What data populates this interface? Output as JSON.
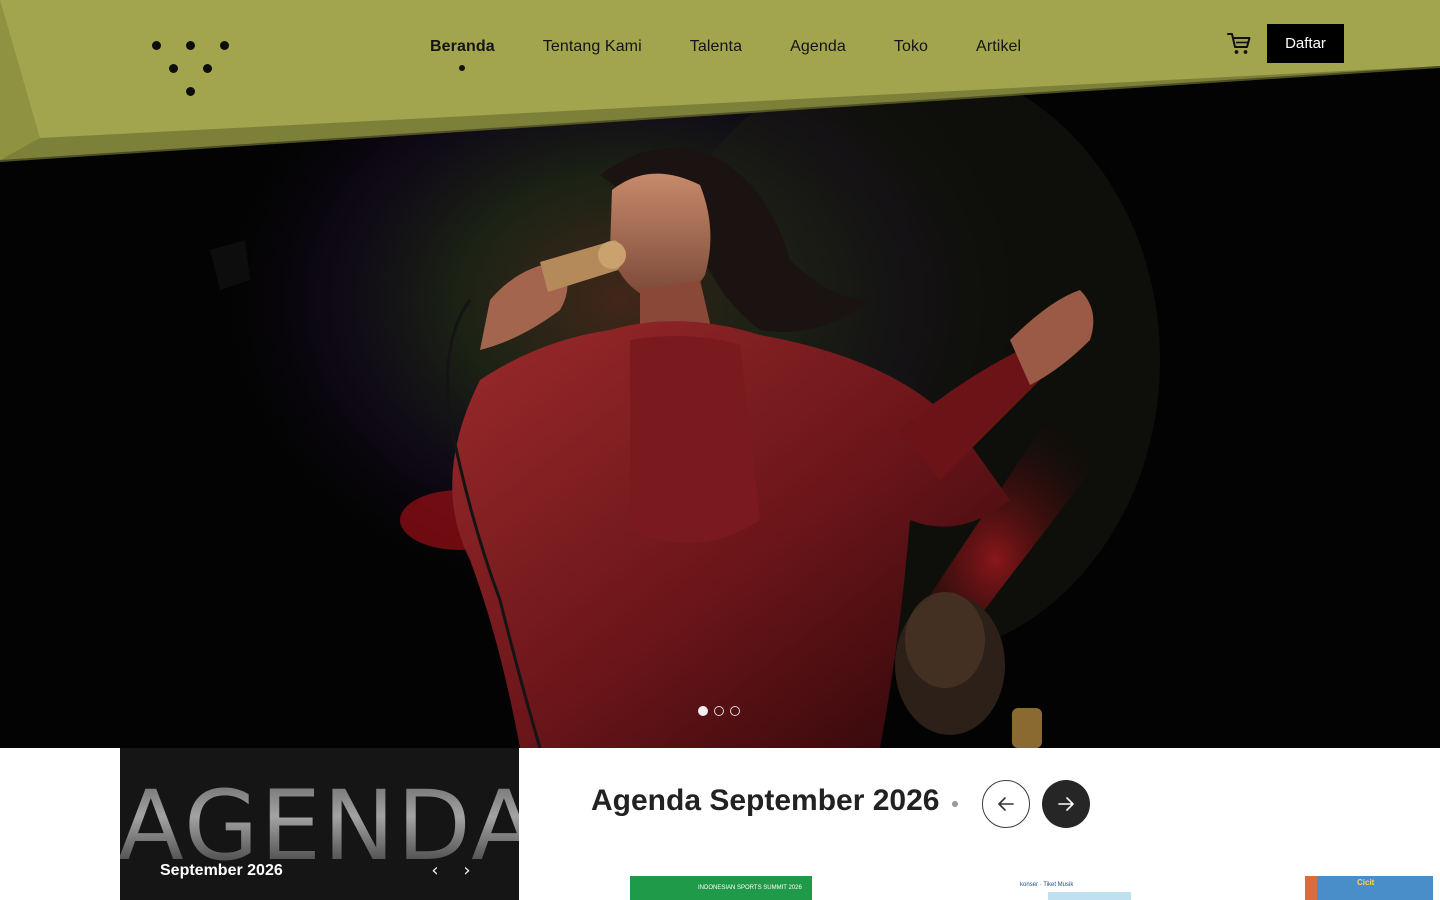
{
  "header": {
    "nav": [
      {
        "label": "Beranda",
        "active": true
      },
      {
        "label": "Tentang Kami",
        "active": false
      },
      {
        "label": "Talenta",
        "active": false
      },
      {
        "label": "Agenda",
        "active": false
      },
      {
        "label": "Toko",
        "active": false
      },
      {
        "label": "Artikel",
        "active": false
      }
    ],
    "cta_label": "Daftar",
    "icons": {
      "logo": "dots-logo-icon",
      "cart": "shopping-cart-icon"
    }
  },
  "hero": {
    "slide_count": 3,
    "active_slide": 1
  },
  "agenda": {
    "card_title": "AGENDA",
    "card_month": "September 2026",
    "heading_prefix": "Agenda",
    "heading_month": "September 2026",
    "card_prev": "‹",
    "card_next": "›",
    "events": [
      {
        "thumb_text": "INDONESIAN SPORTS SUMMIT 2026"
      },
      {
        "thumb_text": "konser · Tiket Musik"
      },
      {
        "thumb_text": "Cicit"
      }
    ]
  },
  "colors": {
    "header_band": "#a2a54d",
    "header_band_shade": "#8f9240",
    "hero_background": "#030303",
    "cta_background": "#000000",
    "agenda_card": "#151515",
    "accent_red": "#8a1e24"
  }
}
